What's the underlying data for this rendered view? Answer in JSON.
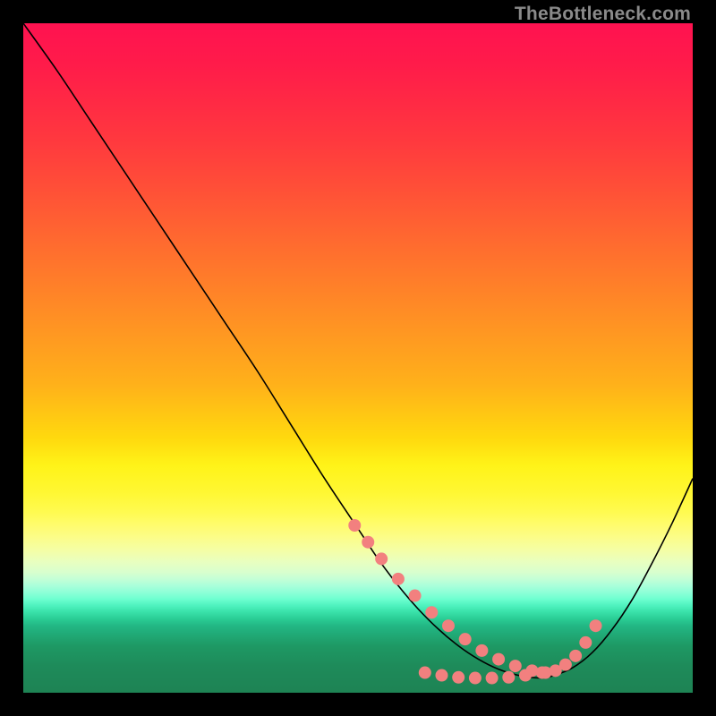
{
  "watermark": "TheBottleneck.com",
  "chart_data": {
    "type": "line",
    "title": "",
    "xlabel": "",
    "ylabel": "",
    "xlim": [
      0,
      100
    ],
    "ylim": [
      0,
      100
    ],
    "series": [
      {
        "name": "curve",
        "x": [
          0,
          5,
          10,
          15,
          20,
          25,
          30,
          35,
          40,
          45,
          50,
          53,
          56,
          59,
          62,
          65,
          68,
          71,
          74,
          77,
          79,
          82,
          85,
          88,
          91,
          94,
          97,
          100
        ],
        "y": [
          100,
          93,
          85.5,
          78,
          70.5,
          63,
          55.5,
          48,
          40,
          32,
          24.5,
          20,
          16,
          12.5,
          9.5,
          7,
          5,
          3.5,
          2.6,
          2.2,
          2.5,
          3.7,
          6,
          9.5,
          14,
          19.5,
          25.5,
          32
        ]
      },
      {
        "name": "markers",
        "x": [
          49.5,
          51.5,
          53.5,
          56,
          58.5,
          61,
          63.5,
          66,
          68.5,
          71,
          73.5,
          76,
          78,
          79.5,
          81,
          82.5,
          84,
          85.5
        ],
        "y": [
          25,
          22.5,
          20,
          17,
          14.5,
          12,
          10,
          8,
          6.3,
          5,
          4,
          3.3,
          3,
          3.3,
          4.2,
          5.5,
          7.5,
          10
        ]
      },
      {
        "name": "marker-cluster-bottom",
        "x": [
          60,
          62.5,
          65,
          67.5,
          70,
          72.5,
          75,
          77.5
        ],
        "y": [
          3,
          2.6,
          2.3,
          2.2,
          2.2,
          2.3,
          2.6,
          3
        ]
      }
    ],
    "marker_style": {
      "radius_px": 7,
      "fill": "#f2807f",
      "stroke": "none"
    }
  }
}
